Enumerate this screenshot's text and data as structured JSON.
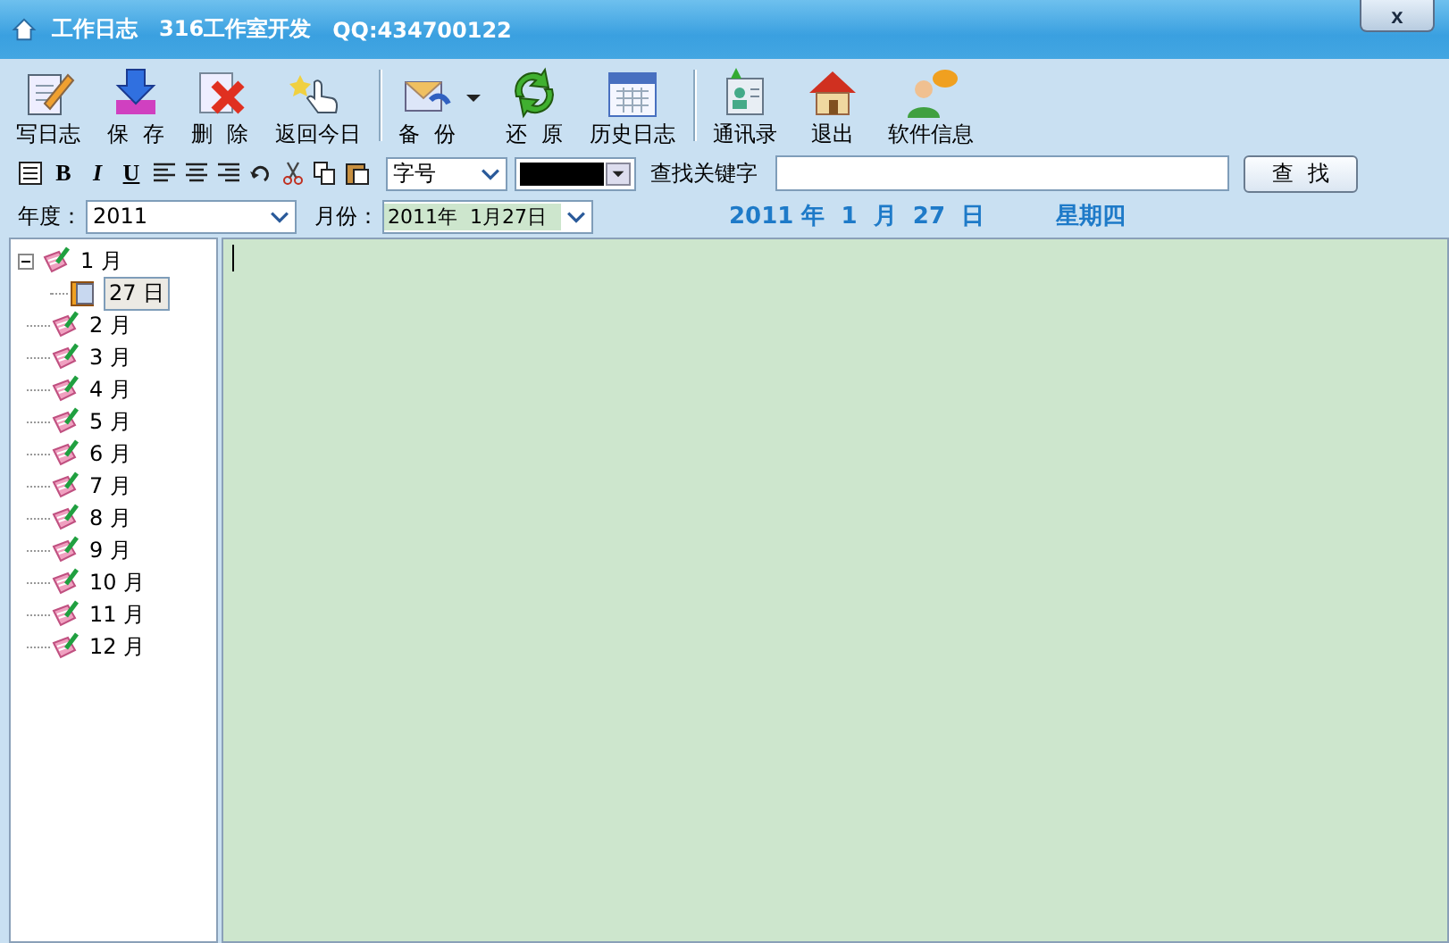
{
  "window": {
    "app_name": "工作日志",
    "developer": "316工作室开发",
    "qq": "QQ:434700122",
    "close": "x"
  },
  "toolbar": [
    {
      "label": "写日志",
      "kind": "button"
    },
    {
      "label": "保  存",
      "kind": "button"
    },
    {
      "label": "删  除",
      "kind": "button"
    },
    {
      "label": "返回今日",
      "kind": "button"
    },
    {
      "label": "备  份",
      "kind": "split"
    },
    {
      "label": "还  原",
      "kind": "button"
    },
    {
      "label": "历史日志",
      "kind": "button"
    },
    {
      "label": "通讯录",
      "kind": "button"
    },
    {
      "label": "退出",
      "kind": "button"
    },
    {
      "label": "软件信息",
      "kind": "button"
    }
  ],
  "format": {
    "bold": "B",
    "italic": "I",
    "underline": "U",
    "font_size": "字号",
    "search_label": "查找关键字",
    "search_button": "查  找"
  },
  "date_bar": {
    "year_label": "年度：",
    "year": "2011",
    "month_label": "月份：",
    "month": "2011年  1月27日",
    "current_date": "2011 年  1  月  27  日",
    "weekday": "星期四"
  },
  "tree": [
    {
      "label": "1 月",
      "expanded": true,
      "children": [
        {
          "label": "27 日",
          "selected": true
        }
      ]
    },
    {
      "label": "2 月"
    },
    {
      "label": "3 月"
    },
    {
      "label": "4 月"
    },
    {
      "label": "5 月"
    },
    {
      "label": "6 月"
    },
    {
      "label": "7 月"
    },
    {
      "label": "8 月"
    },
    {
      "label": "9 月"
    },
    {
      "label": "10 月"
    },
    {
      "label": "11 月"
    },
    {
      "label": "12 月"
    }
  ]
}
